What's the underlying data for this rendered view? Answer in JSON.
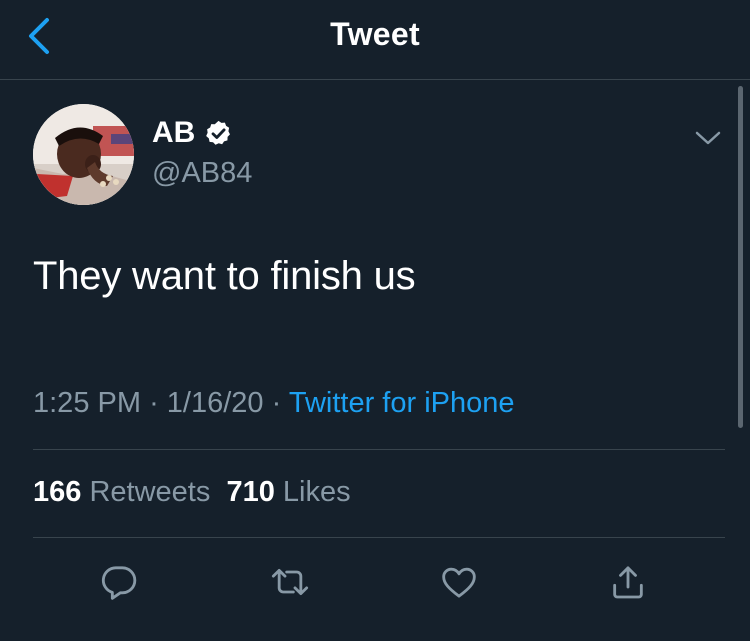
{
  "header": {
    "title": "Tweet",
    "back_icon": "chevron-left-icon"
  },
  "author": {
    "display_name": "AB",
    "handle": "@AB84",
    "verified": true
  },
  "tweet": {
    "text": "They want to finish us",
    "time": "1:25 PM",
    "date": "1/16/20",
    "separator": "·",
    "source": "Twitter for iPhone"
  },
  "stats": {
    "retweets_count": "166",
    "retweets_label": "Retweets",
    "likes_count": "710",
    "likes_label": "Likes"
  },
  "actions": [
    "reply-icon",
    "retweet-icon",
    "like-icon",
    "share-icon"
  ],
  "colors": {
    "background": "#15202b",
    "accent": "#1da1f2",
    "secondary_text": "#8899a6",
    "divider": "#38444d"
  }
}
